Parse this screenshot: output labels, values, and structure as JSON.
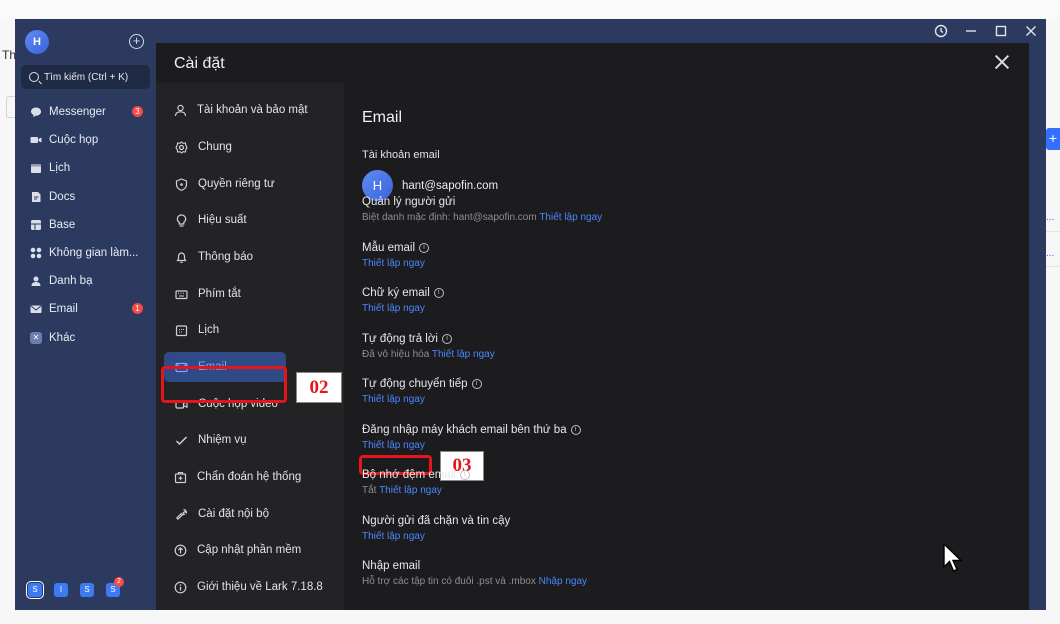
{
  "background": {
    "left_text": "Th",
    "right_button": "+",
    "right_dots": "..."
  },
  "window": {
    "controls": [
      "history-icon",
      "minimize-icon",
      "maximize-icon",
      "close-icon"
    ]
  },
  "nav": {
    "avatar": "H",
    "search_placeholder": "Tìm kiếm (Ctrl + K)",
    "items": [
      {
        "label": "Messenger",
        "icon": "chat-icon",
        "badge": "3"
      },
      {
        "label": "Cuộc họp",
        "icon": "video-icon",
        "badge": ""
      },
      {
        "label": "Lịch",
        "icon": "calendar-icon",
        "badge": ""
      },
      {
        "label": "Docs",
        "icon": "docs-icon",
        "badge": ""
      },
      {
        "label": "Base",
        "icon": "base-icon",
        "badge": ""
      },
      {
        "label": "Không gian làm...",
        "icon": "workspace-icon",
        "badge": ""
      },
      {
        "label": "Danh bạ",
        "icon": "contacts-icon",
        "badge": ""
      },
      {
        "label": "Email",
        "icon": "mail-icon",
        "badge": "1"
      },
      {
        "label": "Khác",
        "icon": "more-icon",
        "badge": ""
      }
    ],
    "bottom_apps": [
      {
        "label": "S",
        "badge": ""
      },
      {
        "label": "I",
        "badge": ""
      },
      {
        "label": "S",
        "badge": ""
      },
      {
        "label": "S",
        "badge": "2"
      }
    ]
  },
  "dialog": {
    "title": "Cài đặt",
    "sidebar": [
      {
        "label": "Tài khoản và bảo mật",
        "icon": "user-icon"
      },
      {
        "label": "Chung",
        "icon": "gear-icon"
      },
      {
        "label": "Quyền riêng tư",
        "icon": "shield-icon"
      },
      {
        "label": "Hiệu suất",
        "icon": "lightbulb-icon"
      },
      {
        "label": "Thông báo",
        "icon": "bell-icon"
      },
      {
        "label": "Phím tắt",
        "icon": "keyboard-icon"
      },
      {
        "label": "Lịch",
        "icon": "calendar-icon"
      },
      {
        "label": "Email",
        "icon": "mail-icon"
      },
      {
        "label": "Cuộc họp video",
        "icon": "video-icon"
      },
      {
        "label": "Nhiệm vụ",
        "icon": "task-icon"
      },
      {
        "label": "Chẩn đoán hệ thống",
        "icon": "diagnosis-icon"
      },
      {
        "label": "Cài đặt nội bộ",
        "icon": "wrench-icon"
      },
      {
        "label": "Cập nhật phần mềm",
        "icon": "update-icon"
      },
      {
        "label": "Giới thiệu về Lark 7.18.8",
        "icon": "info-icon"
      }
    ],
    "annotation_02": "02",
    "annotation_03": "03",
    "content": {
      "title": "Email",
      "account_label": "Tài khoản email",
      "account_avatar": "H",
      "account_email": "hant@sapofin.com",
      "rows": [
        {
          "title": "Quản lý người gửi",
          "info": false,
          "sub": "Biệt danh mặc định: hant@sapofin.com",
          "link": "Thiết lập ngay"
        },
        {
          "title": "Mẫu email",
          "info": true,
          "sub": "",
          "link": "Thiết lập ngay"
        },
        {
          "title": "Chữ ký email",
          "info": true,
          "sub": "",
          "link": "Thiết lập ngay"
        },
        {
          "title": "Tự động trả lời",
          "info": true,
          "sub": "Đã vô hiệu hóa",
          "link": "Thiết lập ngay"
        },
        {
          "title": "Tự động chuyển tiếp",
          "info": true,
          "sub": "",
          "link": "Thiết lập ngay"
        },
        {
          "title": "Đăng nhập máy khách email bên thứ ba",
          "info": true,
          "sub": "",
          "link": "Thiết lập ngay"
        },
        {
          "title": "Bộ nhớ đệm email",
          "info": true,
          "sub": "Tắt",
          "link": "Thiết lập ngay"
        },
        {
          "title": "Người gửi đã chặn và tin cậy",
          "info": false,
          "sub": "",
          "link": "Thiết lập ngay"
        },
        {
          "title": "Nhập email",
          "info": false,
          "sub": "Hỗ trợ các tập tin có đuôi .pst và .mbox",
          "link": "Nhập ngay"
        }
      ]
    }
  }
}
